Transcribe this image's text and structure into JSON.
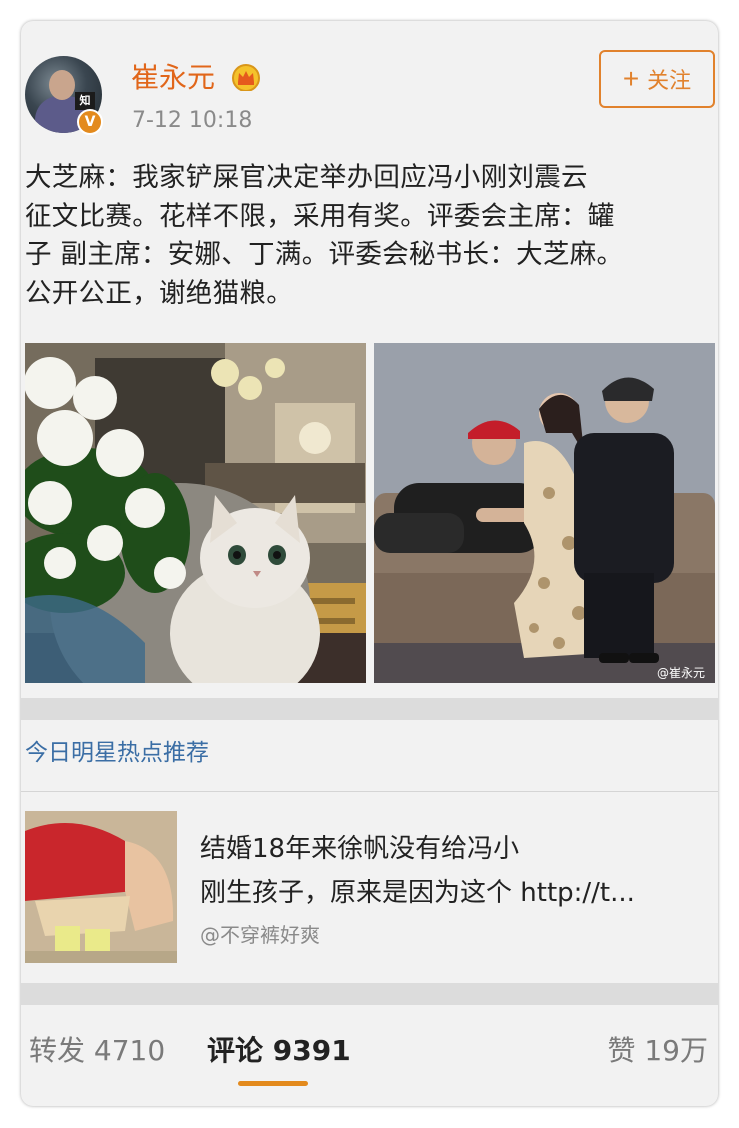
{
  "post": {
    "username": "崔永元",
    "timestamp": "7-12 10:18",
    "follow_label": "关注",
    "verified_badge": "V",
    "avatar_sign_text": "知",
    "text_lines": [
      "大芝麻：我家铲屎官决定举办回应冯小刚刘震云",
      "征文比赛。花样不限，采用有奖。评委会主席：罐",
      "子 副主席：安娜、丁满。评委会秘书长：大芝麻。",
      "公开公正，谢绝猫粮。"
    ],
    "images": [
      {
        "icon": "cat-photo"
      },
      {
        "icon": "people-on-sofa-photo",
        "watermark": "@崔永元"
      }
    ]
  },
  "recommendation": {
    "header": "今日明星热点推荐",
    "title_lines": [
      "结婚18年来徐帆没有给冯小",
      "刚生孩子，原来是因为这个 http://t..."
    ],
    "author": "@不穿裤好爽"
  },
  "stats": {
    "forward": "转发 4710",
    "comment": "评论 9391",
    "like": "赞 19万"
  },
  "colors": {
    "accent": "#e1661a",
    "link_blue": "#3b6ea5",
    "card_bg": "#f2f2f2"
  }
}
